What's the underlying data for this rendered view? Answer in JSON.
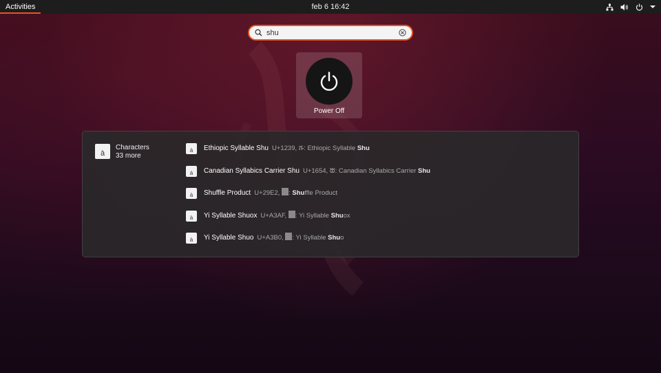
{
  "topbar": {
    "activities_label": "Activities",
    "clock": "feb 6  16:42",
    "tray_icons": [
      "network-icon",
      "volume-icon",
      "power-icon",
      "dropdown-arrow-icon"
    ]
  },
  "search": {
    "value": "shu",
    "icon": "search-icon",
    "clear_icon": "clear-icon"
  },
  "app_results": [
    {
      "label": "Power Off",
      "icon": "power-icon"
    }
  ],
  "provider": {
    "name": "Characters",
    "more": "33 more",
    "icon_glyph": "à"
  },
  "results": [
    {
      "title": "Ethiopic Syllable Shu",
      "desc_prefix": "U+1239, ሹ: Ethiopic Syllable ",
      "desc_bold": "Shu",
      "desc_suffix": "",
      "glyph_box": false
    },
    {
      "title": "Canadian Syllabics Carrier Shu",
      "desc_prefix": "U+1654, ᙔ: Canadian Syllabics Carrier ",
      "desc_bold": "Shu",
      "desc_suffix": "",
      "glyph_box": false
    },
    {
      "title": "Shuffle Product",
      "desc_prefix": "U+29E2, ",
      "desc_mid": ": ",
      "desc_bold": "Shu",
      "desc_suffix": "ffle Product",
      "glyph_box": true
    },
    {
      "title": "Yi Syllable Shuox",
      "desc_prefix": "U+A3AF, ",
      "desc_mid": ": Yi Syllable ",
      "desc_bold": "Shu",
      "desc_suffix": "ox",
      "glyph_box": true
    },
    {
      "title": "Yi Syllable Shuo",
      "desc_prefix": "U+A3B0, ",
      "desc_mid": ": Yi Syllable ",
      "desc_bold": "Shu",
      "desc_suffix": "o",
      "glyph_box": true
    }
  ],
  "colors": {
    "accent": "#e95420",
    "topbar": "#1d1d1d",
    "panel": "#2a282a"
  }
}
